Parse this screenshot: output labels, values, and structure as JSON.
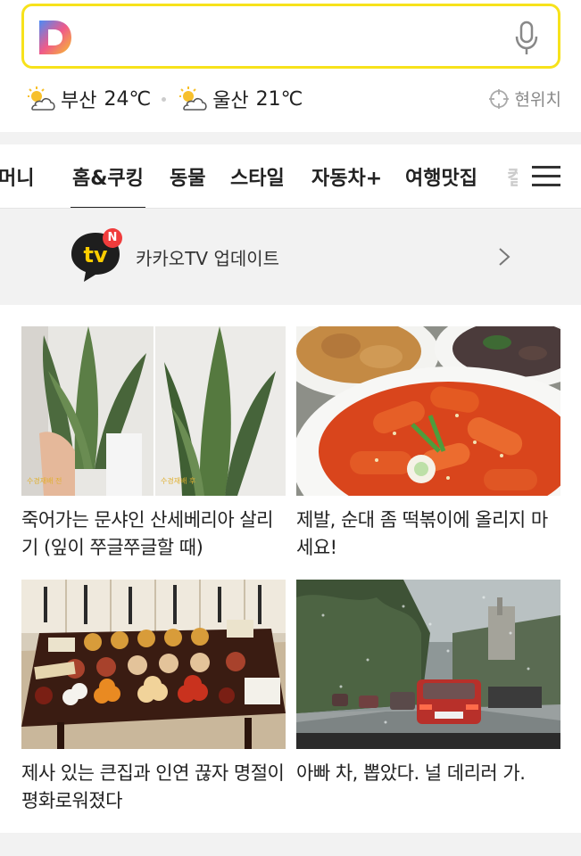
{
  "search": {
    "placeholder": ""
  },
  "weather": [
    {
      "city": "부산",
      "temp": "24℃"
    },
    {
      "city": "울산",
      "temp": "21℃"
    }
  ],
  "location_label": "현위치",
  "tabs": [
    "머니",
    "홈&쿠킹",
    "동물",
    "스타일",
    "자동차+",
    "여행맛집",
    "컬"
  ],
  "active_tab": "홈&쿠킹",
  "banner": {
    "badge": "N",
    "logo_text": "tv",
    "text": "카카오TV 업데이트"
  },
  "articles": [
    {
      "title": "죽어가는 문샤인 산세베리아 살리기 (잎이 쭈글쭈글할 때)",
      "captions": [
        "수경재배 전",
        "수경재배 후"
      ]
    },
    {
      "title": "제발, 순대 좀 떡볶이에 올리지 마세요!"
    },
    {
      "title": "제사 있는 큰집과 인연 끊자 명절이 평화로워졌다"
    },
    {
      "title": "아빠 차, 뽑았다. 널 데리러 가."
    }
  ],
  "colors": {
    "accent": "#f7e21b",
    "badge": "#f03c3c"
  }
}
